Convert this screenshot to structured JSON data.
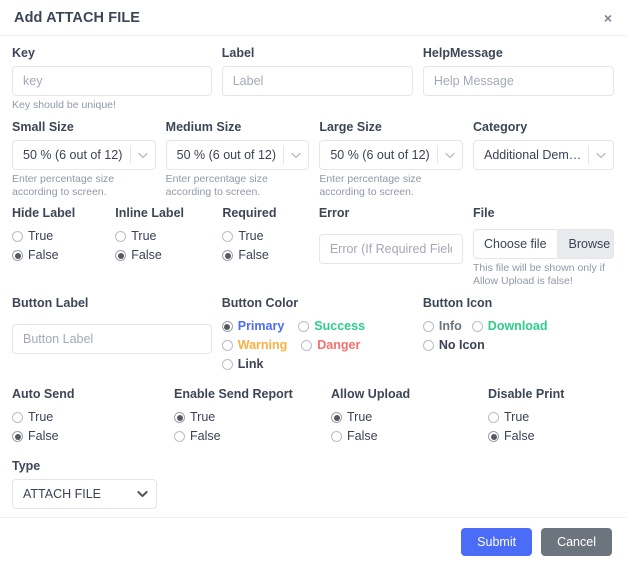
{
  "header": {
    "title": "Add ATTACH FILE",
    "close_label": "×"
  },
  "colors": {
    "primary": "#4a6cf7",
    "success": "#2dce89",
    "warning": "#fbb040",
    "danger": "#f5706e",
    "link": "#3c4257",
    "muted": "#9098a9",
    "cancel": "#6c757d"
  },
  "fields": {
    "key": {
      "label": "Key",
      "value": "",
      "placeholder": "key",
      "help": "Key should be unique!"
    },
    "label": {
      "label": "Label",
      "value": "",
      "placeholder": "Label"
    },
    "help_message": {
      "label": "HelpMessage",
      "value": "",
      "placeholder": "Help Message"
    },
    "small_size": {
      "label": "Small Size",
      "value": "50 % (6 out of 12)",
      "help": "Enter percentage size according to screen."
    },
    "medium_size": {
      "label": "Medium Size",
      "value": "50 % (6 out of 12)",
      "help": "Enter percentage size according to screen."
    },
    "large_size": {
      "label": "Large Size",
      "value": "50 % (6 out of 12)",
      "help": "Enter percentage size according to screen."
    },
    "category": {
      "label": "Category",
      "value": "Additional Demog..."
    },
    "hide_label": {
      "label": "Hide Label",
      "options": [
        {
          "label": "True",
          "selected": false
        },
        {
          "label": "False",
          "selected": true
        }
      ]
    },
    "inline_label": {
      "label": "Inline Label",
      "options": [
        {
          "label": "True",
          "selected": false
        },
        {
          "label": "False",
          "selected": true
        }
      ]
    },
    "required": {
      "label": "Required",
      "options": [
        {
          "label": "True",
          "selected": false
        },
        {
          "label": "False",
          "selected": true
        }
      ]
    },
    "error": {
      "label": "Error",
      "value": "",
      "placeholder": "Error (If Required Field)"
    },
    "file": {
      "label": "File",
      "choose_label": "Choose file",
      "browse_label": "Browse",
      "help": "This file will be shown only if Allow Upload is false!"
    },
    "button_label": {
      "label": "Button Label",
      "value": "",
      "placeholder": "Button Label"
    },
    "button_color": {
      "label": "Button Color",
      "options": [
        {
          "label": "Primary",
          "selected": true,
          "color": "#4a6cf7"
        },
        {
          "label": "Success",
          "selected": false,
          "color": "#2dce89"
        },
        {
          "label": "Warning",
          "selected": false,
          "color": "#fbb040"
        },
        {
          "label": "Danger",
          "selected": false,
          "color": "#f5706e"
        },
        {
          "label": "Link",
          "selected": false,
          "color": "#3c4257"
        }
      ]
    },
    "button_icon": {
      "label": "Button Icon",
      "options": [
        {
          "label": "Info",
          "selected": false,
          "color": "#6c757d"
        },
        {
          "label": "Download",
          "selected": false,
          "color": "#2dce89"
        },
        {
          "label": "No Icon",
          "selected": false,
          "color": "#3c4257"
        }
      ]
    },
    "auto_send": {
      "label": "Auto Send",
      "options": [
        {
          "label": "True",
          "selected": false
        },
        {
          "label": "False",
          "selected": true
        }
      ]
    },
    "enable_send_report": {
      "label": "Enable Send Report",
      "options": [
        {
          "label": "True",
          "selected": true
        },
        {
          "label": "False",
          "selected": false
        }
      ]
    },
    "allow_upload": {
      "label": "Allow Upload",
      "options": [
        {
          "label": "True",
          "selected": true
        },
        {
          "label": "False",
          "selected": false
        }
      ]
    },
    "disable_print": {
      "label": "Disable Print",
      "options": [
        {
          "label": "True",
          "selected": false
        },
        {
          "label": "False",
          "selected": true
        }
      ]
    },
    "type": {
      "label": "Type",
      "value": "ATTACH FILE"
    }
  },
  "footer": {
    "submit_label": "Submit",
    "cancel_label": "Cancel"
  }
}
